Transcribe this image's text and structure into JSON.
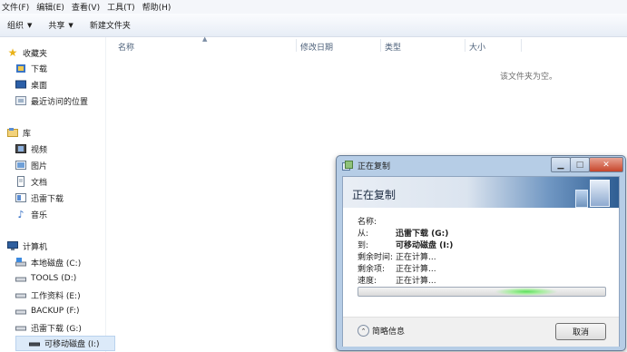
{
  "menu": [
    "文件(F)",
    "编辑(E)",
    "查看(V)",
    "工具(T)",
    "帮助(H)"
  ],
  "toolbar": {
    "organize": "组织",
    "share": "共享",
    "new_folder": "新建文件夹"
  },
  "nav": {
    "favorites": "收藏夹",
    "fav_items": [
      "下载",
      "桌面",
      "最近访问的位置"
    ],
    "libraries": "库",
    "lib_items": [
      "视频",
      "图片",
      "文档",
      "迅雷下载",
      "音乐"
    ],
    "computer": "计算机",
    "drives": [
      "本地磁盘 (C:)",
      "TOOLS (D:)",
      "工作资料 (E:)",
      "BACKUP (F:)",
      "迅雷下载 (G:)",
      "可移动磁盘 (I:)"
    ]
  },
  "columns": {
    "name": "名称",
    "modified": "修改日期",
    "type": "类型",
    "size": "大小"
  },
  "empty_message": "该文件夹为空。",
  "dialog": {
    "window_title": "正在复制",
    "header": "正在复制",
    "name_label": "名称:",
    "from_label": "从:",
    "from_value": "迅雷下载 (G:)",
    "to_label": "到:",
    "to_value": "可移动磁盘 (I:)",
    "time_label": "剩余时间:",
    "time_value": "正在计算...",
    "items_label": "剩余项:",
    "items_value": "正在计算...",
    "speed_label": "速度:",
    "speed_value": "正在计算...",
    "brief_label": "简略信息",
    "cancel_label": "取消"
  }
}
